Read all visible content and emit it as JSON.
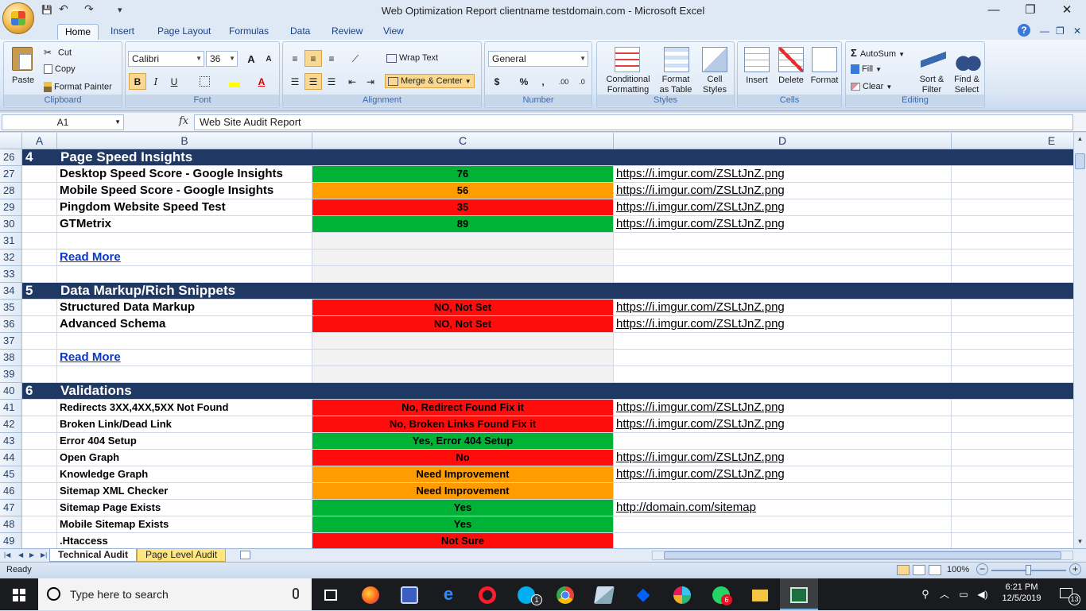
{
  "window": {
    "title": "Web Optimization Report clientname testdomain.com - Microsoft Excel",
    "minimize": "—",
    "restore": "❐",
    "close": "✕"
  },
  "qat": {
    "save": "💾",
    "undo": "↶",
    "redo": "↷",
    "customize": "▾"
  },
  "tabs": [
    "Home",
    "Insert",
    "Page Layout",
    "Formulas",
    "Data",
    "Review",
    "View"
  ],
  "help": {
    "help": "?",
    "min": "—",
    "restore": "❐",
    "close": "✕"
  },
  "ribbon": {
    "clipboard": {
      "label": "Clipboard",
      "paste": "Paste",
      "cut": "Cut",
      "copy": "Copy",
      "format_painter": "Format Painter"
    },
    "font": {
      "label": "Font",
      "name": "Calibri",
      "size": "36",
      "grow": "A",
      "shrink": "A",
      "bold": "B",
      "italic": "I",
      "underline": "U",
      "font_color_letter": "A"
    },
    "alignment": {
      "label": "Alignment",
      "wrap": "Wrap Text",
      "merge": "Merge & Center"
    },
    "number": {
      "label": "Number",
      "format": "General",
      "currency": "$",
      "percent": "%",
      "comma": ",",
      "inc_decimal": ".00",
      "dec_decimal": ".0"
    },
    "styles": {
      "label": "Styles",
      "conditional_1": "Conditional",
      "conditional_2": "Formatting",
      "table_1": "Format",
      "table_2": "as Table",
      "cell_1": "Cell",
      "cell_2": "Styles"
    },
    "cells": {
      "label": "Cells",
      "insert": "Insert",
      "delete": "Delete",
      "format": "Format"
    },
    "editing": {
      "label": "Editing",
      "autosum": "AutoSum",
      "fill": "Fill",
      "clear": "Clear",
      "sort_1": "Sort &",
      "sort_2": "Filter",
      "find_1": "Find &",
      "find_2": "Select"
    }
  },
  "formula_bar": {
    "name_box": "A1",
    "fx": "fx",
    "content": "Web Site Audit Report"
  },
  "columns": [
    "A",
    "B",
    "C",
    "D",
    "E"
  ],
  "rows": [
    {
      "num": "26",
      "type": "section",
      "a": "4",
      "b": "Page Speed Insights"
    },
    {
      "num": "27",
      "type": "item",
      "b": "Desktop Speed Score - Google Insights",
      "c": "76",
      "status": "green",
      "d": "https://i.imgur.com/ZSLtJnZ.png"
    },
    {
      "num": "28",
      "type": "item",
      "b": "Mobile Speed Score - Google Insights",
      "c": "56",
      "status": "orange",
      "d": "https://i.imgur.com/ZSLtJnZ.png"
    },
    {
      "num": "29",
      "type": "item",
      "b": "Pingdom Website Speed Test",
      "c": "35",
      "status": "red",
      "d": "https://i.imgur.com/ZSLtJnZ.png"
    },
    {
      "num": "30",
      "type": "item",
      "b": "GTMetrix",
      "c": "89",
      "status": "green",
      "d": "https://i.imgur.com/ZSLtJnZ.png"
    },
    {
      "num": "31",
      "type": "blank"
    },
    {
      "num": "32",
      "type": "readmore",
      "b": "Read More"
    },
    {
      "num": "33",
      "type": "blank"
    },
    {
      "num": "34",
      "type": "section",
      "a": "5",
      "b": "Data Markup/Rich Snippets"
    },
    {
      "num": "35",
      "type": "item",
      "b": "Structured Data Markup",
      "c": "NO, Not Set",
      "status": "red",
      "d": "https://i.imgur.com/ZSLtJnZ.png"
    },
    {
      "num": "36",
      "type": "item",
      "b": "Advanced Schema",
      "c": "NO, Not Set",
      "status": "red",
      "d": "https://i.imgur.com/ZSLtJnZ.png"
    },
    {
      "num": "37",
      "type": "blank"
    },
    {
      "num": "38",
      "type": "readmore",
      "b": "Read More"
    },
    {
      "num": "39",
      "type": "blank"
    },
    {
      "num": "40",
      "type": "section",
      "a": "6",
      "b": "Validations"
    },
    {
      "num": "41",
      "type": "item",
      "small": true,
      "b": "Redirects 3XX,4XX,5XX Not Found",
      "c": "No, Redirect Found Fix it",
      "status": "red",
      "d": "https://i.imgur.com/ZSLtJnZ.png"
    },
    {
      "num": "42",
      "type": "item",
      "small": true,
      "b": "Broken Link/Dead Link",
      "c": "No, Broken Links Found Fix it",
      "status": "red",
      "d": "https://i.imgur.com/ZSLtJnZ.png"
    },
    {
      "num": "43",
      "type": "item",
      "small": true,
      "b": "Error 404 Setup",
      "c": "Yes, Error 404 Setup",
      "status": "green",
      "d": ""
    },
    {
      "num": "44",
      "type": "item",
      "small": true,
      "b": "Open Graph",
      "c": "No",
      "status": "red",
      "d": "https://i.imgur.com/ZSLtJnZ.png"
    },
    {
      "num": "45",
      "type": "item",
      "small": true,
      "b": "Knowledge Graph",
      "c": "Need Improvement",
      "status": "orange",
      "d": "https://i.imgur.com/ZSLtJnZ.png"
    },
    {
      "num": "46",
      "type": "item",
      "small": true,
      "b": "Sitemap XML Checker",
      "c": "Need Improvement",
      "status": "orange",
      "d": ""
    },
    {
      "num": "47",
      "type": "item",
      "small": true,
      "b": "Sitemap Page Exists",
      "c": "Yes",
      "status": "green",
      "d": "http://domain.com/sitemap"
    },
    {
      "num": "48",
      "type": "item",
      "small": true,
      "b": "Mobile Sitemap Exists",
      "c": "Yes",
      "status": "green",
      "d": ""
    },
    {
      "num": "49",
      "type": "item",
      "small": true,
      "b": ".Htaccess",
      "c": "Not Sure",
      "status": "red",
      "d": ""
    }
  ],
  "status_colors": {
    "green": "#00b236",
    "orange": "#ff9c00",
    "red": "#ff0d0d",
    "section": "#1f3864"
  },
  "sheets": [
    {
      "name": "Technical Audit",
      "active": true
    },
    {
      "name": "Page Level Audit",
      "active": false
    }
  ],
  "status": {
    "ready": "Ready",
    "zoom": "100%",
    "zoom_out": "−",
    "zoom_in": "+"
  },
  "taskbar": {
    "search_placeholder": "Type here to search",
    "time": "6:21 PM",
    "date": "12/5/2019",
    "notifications": "13",
    "skype_badge": "1",
    "whatsapp_badge": "6"
  }
}
